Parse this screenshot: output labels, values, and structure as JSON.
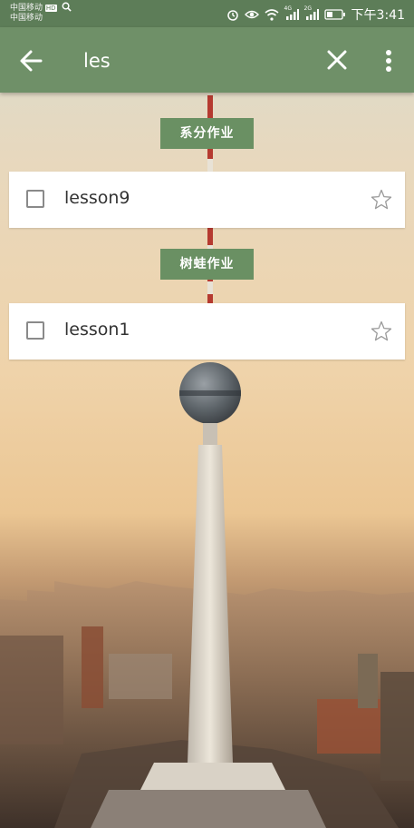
{
  "status_bar": {
    "carrier_1": "中国移动",
    "carrier_2": "中国移动",
    "hd_badge": "HD",
    "network_1": "4G",
    "network_2": "2G",
    "time": "下午3:41",
    "icons": [
      "search-icon",
      "alarm-icon",
      "eye-icon",
      "wifi-icon",
      "signal-icon",
      "signal-icon",
      "battery-icon"
    ]
  },
  "app_bar": {
    "search_value": "les",
    "icons": [
      "arrow-left-icon",
      "close-icon",
      "more-vert-icon"
    ]
  },
  "results": [
    {
      "group": "系分作业",
      "item": "lesson9",
      "checked": false,
      "starred": false
    },
    {
      "group": "树蛙作业",
      "item": "lesson1",
      "checked": false,
      "starred": false
    }
  ],
  "colors": {
    "status_bar": "#5d7d58",
    "app_bar": "#6f9068",
    "badge": "#6a9063",
    "card": "#ffffff"
  }
}
